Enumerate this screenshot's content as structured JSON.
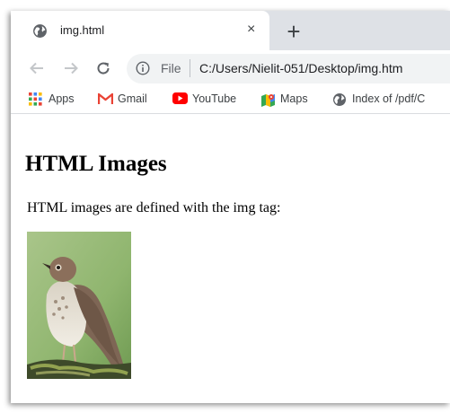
{
  "tab": {
    "title": "img.html",
    "favicon": "globe-icon",
    "close_glyph": "×"
  },
  "new_tab_glyph": "+",
  "toolbar": {
    "back_icon": "arrow-left-icon",
    "forward_icon": "arrow-right-icon",
    "reload_icon": "reload-icon",
    "info_icon": "info-icon",
    "file_label": "File",
    "url": "C:/Users/Nielit-051/Desktop/img.htm"
  },
  "bookmarks": [
    {
      "label": "Apps",
      "icon": "apps-grid-icon"
    },
    {
      "label": "Gmail",
      "icon": "gmail-icon"
    },
    {
      "label": "YouTube",
      "icon": "youtube-icon"
    },
    {
      "label": "Maps",
      "icon": "maps-icon"
    },
    {
      "label": "Index of /pdf/C",
      "icon": "globe-icon"
    }
  ],
  "page": {
    "heading": "HTML Images",
    "paragraph": "HTML images are defined with the img tag:",
    "image_subject": "bird-photo"
  },
  "colors": {
    "tabstrip": "#dee1e6",
    "omnibox": "#f1f3f4",
    "gmail_red": "#ea4335",
    "youtube_red": "#ff0000"
  }
}
